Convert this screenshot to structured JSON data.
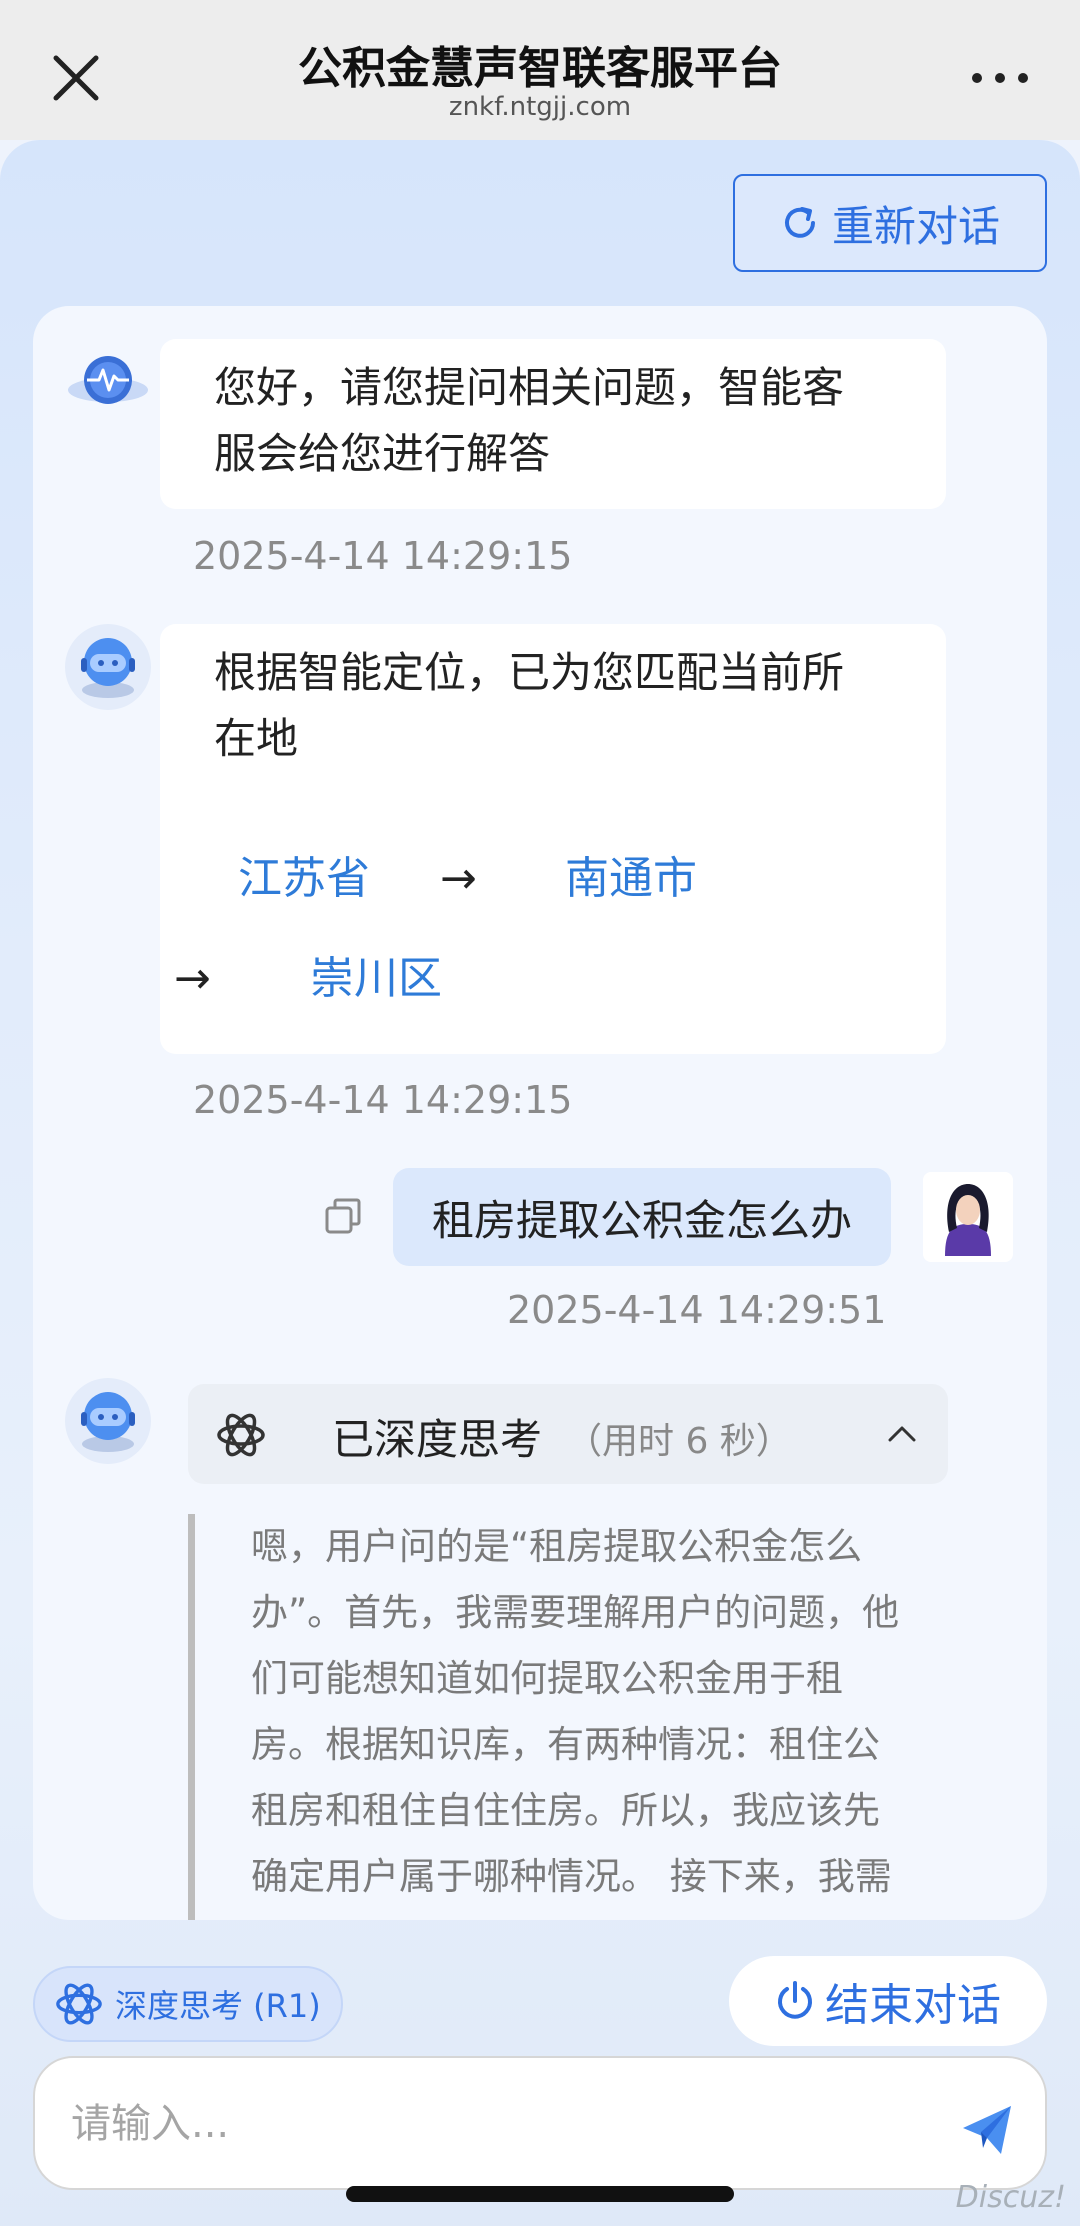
{
  "header": {
    "title": "公积金慧声智联客服平台",
    "domain": "znkf.ntgjj.com"
  },
  "toolbar": {
    "restart_label": "重新对话"
  },
  "messages": {
    "m1": {
      "text_line1": "您好，请您提问相关问题，智能客",
      "text_line2": "服会给您进行解答",
      "timestamp": "2025-4-14 14:29:15"
    },
    "m2": {
      "text_line1": "根据智能定位，已为您匹配当前所",
      "text_line2": "在地",
      "province": "江苏省",
      "city": "南通市",
      "district": "崇川区",
      "arrow": "→",
      "timestamp": "2025-4-14 14:29:15"
    },
    "m3": {
      "text": "租房提取公积金怎么办",
      "timestamp": "2025-4-14 14:29:51"
    },
    "m4": {
      "think_title": "已深度思考",
      "think_duration": "（用时 6 秒）",
      "lines": [
        "嗯，用户问的是“租房提取公积金怎么",
        "办”。首先，我需要理解用户的问题，他",
        "们可能想知道如何提取公积金用于租",
        "房。根据知识库，有两种情况：租住公",
        "租房和租住自住住房。所以，我应该先",
        "确定用户属于哪种情况。 接下来，我需"
      ]
    }
  },
  "footer": {
    "deep_think_label": "深度思考 (R1)",
    "end_label": "结束对话",
    "input_placeholder": "请输入..."
  },
  "watermark": "Discuz!",
  "colors": {
    "accent": "#2e6fe0",
    "link": "#2e7bd8"
  }
}
